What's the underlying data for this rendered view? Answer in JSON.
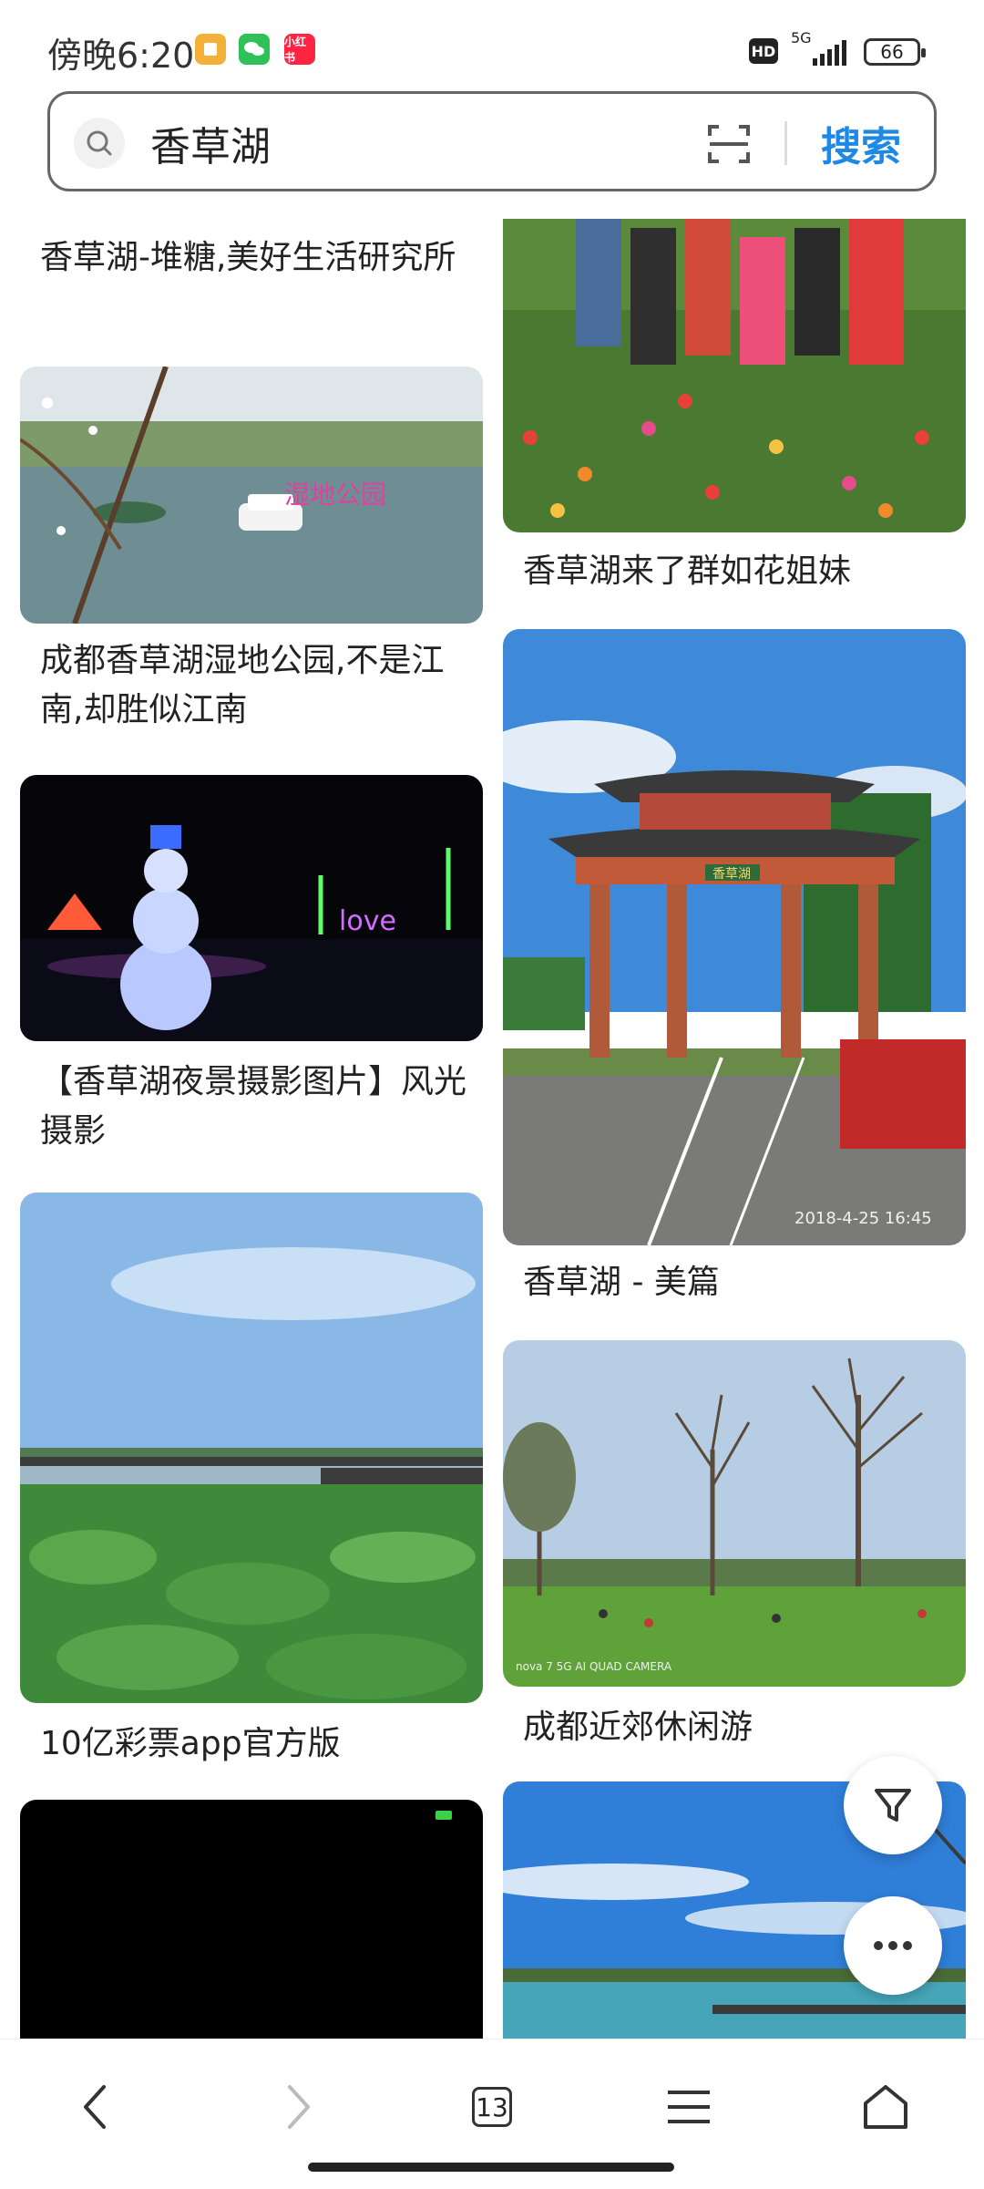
{
  "status_bar": {
    "time": "傍晚6:20",
    "hd": "HD",
    "network": "5G",
    "battery": "66"
  },
  "search": {
    "query": "香草湖",
    "button": "搜索"
  },
  "captions": {
    "left_0": "香草湖-堆糖,美好生活研究所",
    "left_1": "成都香草湖湿地公园,不是江南,却胜似江南",
    "left_2": "【香草湖夜景摄影图片】风光摄影",
    "left_3": "10亿彩票app官方版",
    "right_0": "香草湖来了群如花姐妹",
    "right_1": "香草湖 - 美篇",
    "right_2": "成都近郊休闲游"
  },
  "image_overlays": {
    "gate_timestamp": "2018-4-25 16:45",
    "camera_watermark": "nova 7 5G AI QUAD CAMERA",
    "gate_plaque": "香草湖",
    "wetland_text": "湿地公园",
    "love_light": "love"
  },
  "nav": {
    "tabs_count": "13"
  },
  "colors": {
    "accent": "#1e88e5"
  }
}
